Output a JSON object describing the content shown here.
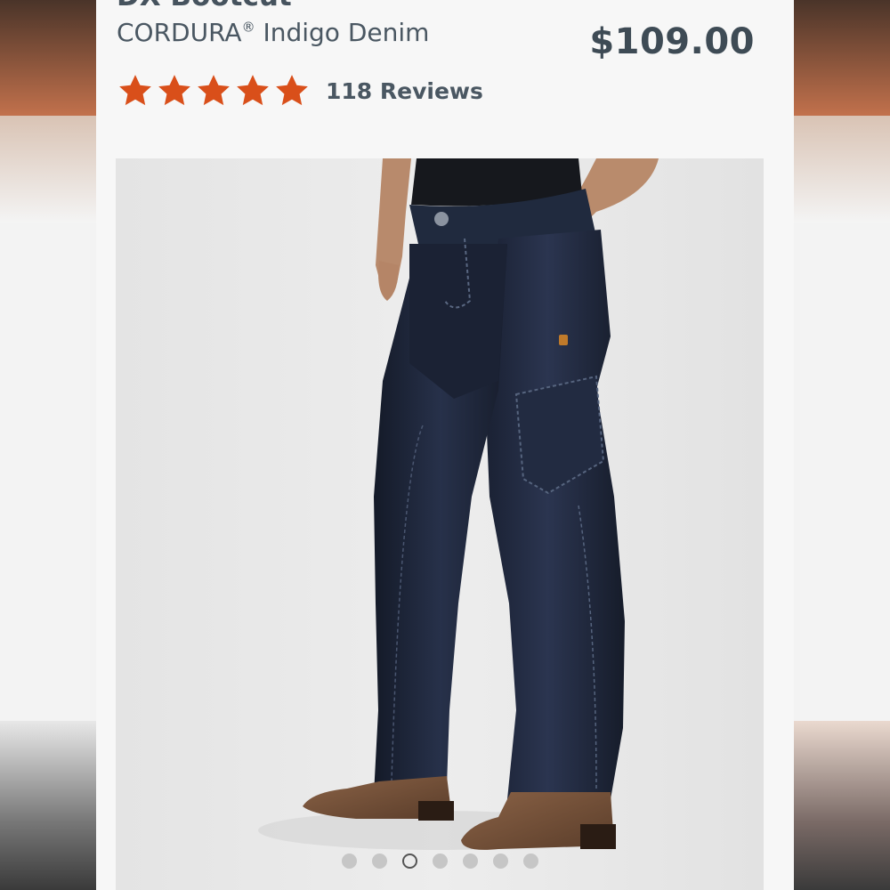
{
  "product": {
    "name": "DX Bootcut",
    "variant_main": "CORDURA",
    "variant_mark": "®",
    "variant_rest": " Indigo Denim",
    "price": "$109.00"
  },
  "rating": {
    "stars": 5,
    "reviews_label": "118 Reviews"
  },
  "gallery": {
    "slide_count": 7,
    "active_slide": 3
  },
  "colors": {
    "star": "#d94f1a",
    "text": "#46535e",
    "denim": "#1f2738"
  }
}
